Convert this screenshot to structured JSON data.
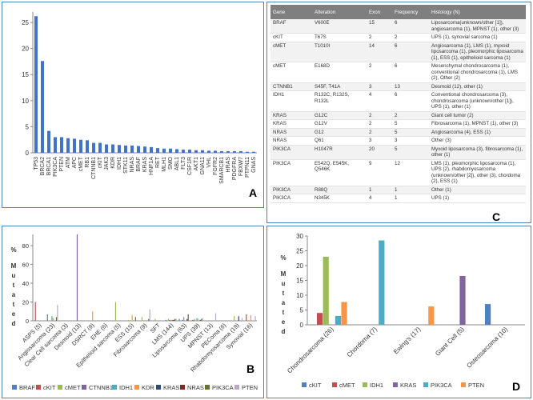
{
  "chart_data": [
    {
      "panel": "A",
      "type": "bar",
      "color": "#4472c4",
      "ylim": [
        0,
        27
      ],
      "yticks": [
        0,
        5,
        10,
        15,
        20,
        25
      ],
      "categories": [
        "TP53",
        "BRCA2",
        "BRCA1",
        "PIK3CA",
        "PTEN",
        "ATM",
        "APC",
        "cMET",
        "RB1",
        "CTNNB1",
        "cKIT",
        "JAK3",
        "KDR",
        "IDH1",
        "STK11",
        "NRAS",
        "BRAF",
        "KRAS",
        "HNF1A",
        "RET",
        "MLH1",
        "SMO",
        "ABL1",
        "FLT3",
        "CSF1R",
        "AKT1",
        "GNA11",
        "VHL",
        "FGFR2",
        "SMARCB1",
        "HRAS",
        "PDGFRA",
        "FBXW7",
        "PTPN11",
        "GNAS"
      ],
      "values": [
        26.2,
        17.6,
        4.2,
        3.0,
        3.0,
        2.8,
        2.7,
        2.5,
        2.4,
        1.9,
        1.9,
        1.6,
        1.6,
        1.5,
        1.4,
        1.4,
        1.3,
        1.2,
        1.1,
        0.9,
        0.8,
        0.8,
        0.7,
        0.6,
        0.6,
        0.5,
        0.5,
        0.4,
        0.4,
        0.3,
        0.3,
        0.3,
        0.3,
        0.2,
        0.2
      ]
    },
    {
      "panel": "B",
      "type": "bar",
      "ylim": [
        0,
        92
      ],
      "yticks": [
        0,
        20,
        40,
        60,
        80
      ],
      "ylabel_symbol": "%",
      "ylabel_text": "Mutated",
      "categories": [
        "ASPS (5)",
        "Angiosarcoma (23)",
        "Clear Cell sarcoma (3)",
        "Desmoid (13)",
        "DSRCT (9)",
        "EHE (6)",
        "Epithelioid sarcoma (5)",
        "ESS (15)",
        "Fibrosarcoma (9)",
        "SFT",
        "LMS (144)",
        "Liposarcoma (63)",
        "UPS (39)",
        "MPNST (13)",
        "PEComa (6)",
        "Rhabdomyosarcoma (19)",
        "Synovial (16)"
      ],
      "series": [
        {
          "name": "BRAF",
          "color": "#4f81bd",
          "values": [
            0,
            7,
            0,
            0,
            0,
            0,
            0,
            0,
            0,
            0,
            1,
            2,
            1,
            0,
            0,
            0,
            0
          ]
        },
        {
          "name": "cKIT",
          "color": "#c0504d",
          "values": [
            20,
            0,
            0,
            0,
            0,
            0,
            0,
            0,
            0,
            0,
            0,
            0,
            1,
            0,
            0,
            0,
            7
          ]
        },
        {
          "name": "cMET",
          "color": "#9bbb59",
          "values": [
            0,
            0,
            0,
            0,
            0,
            0,
            20,
            1,
            4,
            2,
            2,
            0,
            2,
            0,
            0,
            5,
            0
          ]
        },
        {
          "name": "CTNNB1",
          "color": "#8064a2",
          "values": [
            0,
            0,
            0,
            92,
            0,
            0,
            0,
            0,
            0,
            0,
            1,
            1,
            0,
            0,
            0,
            0,
            0
          ]
        },
        {
          "name": "IDH1",
          "color": "#4bacc6",
          "values": [
            0,
            5,
            0,
            0,
            0,
            0,
            0,
            0,
            0,
            0,
            1,
            4,
            3,
            0,
            0,
            0,
            0
          ]
        },
        {
          "name": "KDR",
          "color": "#f79646",
          "values": [
            0,
            3,
            0,
            0,
            10,
            0,
            0,
            6,
            0,
            0,
            1,
            0,
            2,
            0,
            0,
            0,
            6
          ]
        },
        {
          "name": "KRAS",
          "color": "#2c4d75",
          "values": [
            0,
            0,
            0,
            0,
            0,
            0,
            0,
            0,
            0,
            0,
            1,
            0,
            0,
            0,
            0,
            5,
            0
          ]
        },
        {
          "name": "NRAS",
          "color": "#772c2a",
          "values": [
            0,
            0,
            0,
            0,
            0,
            0,
            0,
            0,
            0,
            0,
            1,
            2,
            1,
            0,
            0,
            0,
            0
          ]
        },
        {
          "name": "PIK3CA",
          "color": "#5f7530",
          "values": [
            0,
            4,
            0,
            0,
            0,
            0,
            0,
            4,
            2,
            0,
            2,
            7,
            2,
            0,
            0,
            0,
            0
          ]
        },
        {
          "name": "PTEN",
          "color": "#b7a8cc",
          "values": [
            0,
            17,
            0,
            0,
            0,
            0,
            0,
            0,
            12,
            0,
            2,
            0,
            3,
            8,
            0,
            3,
            5
          ]
        }
      ]
    },
    {
      "panel": "D",
      "type": "bar",
      "ylim": [
        0,
        30
      ],
      "yticks": [
        0,
        5,
        10,
        15,
        20,
        25,
        30
      ],
      "ylabel_symbol": "%",
      "ylabel_text": "Mutated",
      "categories": [
        "Chondrosarcoma (26)",
        "Chordoma (7)",
        "Ewing's (17)",
        "Giant Cell (5)",
        "Osteosarcoma (10)"
      ],
      "series": [
        {
          "name": "cKIT",
          "color": "#4f81bd",
          "values": [
            0,
            0,
            0,
            0,
            7.0
          ]
        },
        {
          "name": "cMET",
          "color": "#c0504d",
          "values": [
            4.0,
            0,
            0,
            0,
            0
          ]
        },
        {
          "name": "IDH1",
          "color": "#9bbb59",
          "values": [
            23.0,
            0,
            0,
            0,
            0
          ]
        },
        {
          "name": "KRAS",
          "color": "#8064a2",
          "values": [
            0,
            0,
            0,
            16.5,
            0
          ]
        },
        {
          "name": "PIK3CA",
          "color": "#4bacc6",
          "values": [
            3.0,
            28.5,
            0,
            0,
            0
          ]
        },
        {
          "name": "PTEN",
          "color": "#f79646",
          "values": [
            7.7,
            0,
            6.2,
            0,
            0
          ]
        }
      ]
    }
  ],
  "panel_labels": {
    "a": "A",
    "b": "B",
    "c": "C",
    "d": "D"
  },
  "table": {
    "headers": [
      "Gene",
      "Alteration",
      "Exon",
      "Frequency",
      "Histology (N)"
    ],
    "rows": [
      [
        "BRAF",
        "V600E",
        "15",
        "6",
        "Liposarcoma(unknown/other [1]), angiosarcoma (1), MPNST (1), other (3)"
      ],
      [
        "cKIT",
        "T67S",
        "2",
        "2",
        "UPS (1), synovial sarcoma (1)"
      ],
      [
        "cMET",
        "T1010I",
        "14",
        "6",
        "Angiosarcoma (1), LMS (1), myxoid liposarcoma (1), pleomorphic liposarcoma (1), ESS (1), epithelioid sarcoma (1)"
      ],
      [
        "cMET",
        "E168D",
        "2",
        "6",
        "Mesenchymal chondrosarcoma (1), conventional chondrosarcoma (1), LMS (2), Other (2)"
      ],
      [
        "CTNNB1",
        "S45F, T41A",
        "3",
        "13",
        "Desmoid (12), other (1)"
      ],
      [
        "IDH1",
        "R132C, R132S, R132L",
        "4",
        "6",
        "Conventional chondrosarcoma (3), chondrosarcoma (unknown/other [1]), UPS (1), other (1)"
      ],
      [
        "KRAS",
        "G12C",
        "2",
        "2",
        "Giant cell tumor (2)"
      ],
      [
        "KRAS",
        "G12V",
        "2",
        "5",
        "Fibrosarcoma (1), MPNST (1), other (3)"
      ],
      [
        "NRAS",
        "G12",
        "2",
        "5",
        "Angiosarcoma (4), ESS (1)"
      ],
      [
        "NRAS",
        "Q61",
        "3",
        "3",
        "Other (3)"
      ],
      [
        "PIK3CA",
        "H1047R",
        "20",
        "5",
        "Myxoid liposarcoma (3), fibrosarcoma (1), other (1)"
      ],
      [
        "PIK3CA",
        "E542Q, E545K, Q546K",
        "9",
        "12",
        "LMS (1), pleomorphic liposarcoma (1), UPS (2), rhabdomyosarcoma (unknown/other [2]), other (3), chordoma (2), ESS (1)"
      ],
      [
        "PIK3CA",
        "R88Q",
        "1",
        "1",
        "Other (1)"
      ],
      [
        "PIK3CA",
        "N345K",
        "4",
        "1",
        "UPS (1)"
      ]
    ]
  }
}
